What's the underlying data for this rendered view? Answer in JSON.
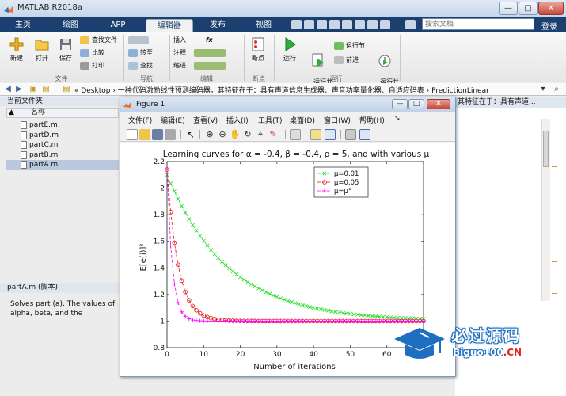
{
  "window": {
    "title": "MATLAB R2018a",
    "min_glyph": "—",
    "max_glyph": "□",
    "close_glyph": "✕"
  },
  "ribbon_tabs": [
    {
      "label": "主页"
    },
    {
      "label": "绘图"
    },
    {
      "label": "APP"
    },
    {
      "label": "编辑器"
    },
    {
      "label": "发布"
    },
    {
      "label": "视图"
    }
  ],
  "search": {
    "placeholder": "搜索文档"
  },
  "login_label": "登录",
  "ribbon": {
    "file_group": {
      "label": "文件",
      "new": "新建",
      "open": "打开",
      "save": "保存",
      "find_files": "查找文件",
      "compare": "比较",
      "print": "打印"
    },
    "nav_group": {
      "label": "导航",
      "goto": "转至",
      "find": "查找"
    },
    "edit_group": {
      "label": "编辑",
      "insert": "插入",
      "comment": "注释",
      "indent": "缩进",
      "fx": "fx"
    },
    "breakpoint_group": {
      "label": "断点",
      "breakpoints": "断点"
    },
    "run_group": {
      "label": "运行",
      "run": "运行",
      "run_advance": "运行并\n前进",
      "run_section": "运行节",
      "advance": "前进",
      "run_time": "运行并\n计时"
    }
  },
  "address": {
    "path": "«  Desktop  ›  一种代码激励线性预测编码器，其特征在于：具有声道信息生成器、声音功率量化器、自适应码表  ›  PredictionLinear"
  },
  "left_panel": {
    "title": "当前文件夹",
    "column_name": "名称",
    "sort_glyph": "▲",
    "files": [
      "partE.m",
      "partD.m",
      "partC.m",
      "partB.m",
      "partA.m"
    ],
    "selected_index": 4,
    "detail_title": "partA.m  (脚本)",
    "detail_text": "Solves part (a). The values of alpha, beta, and the"
  },
  "right_panel": {
    "header": "其特征在于：具有声道..."
  },
  "figure": {
    "title": "Figure 1",
    "menu": [
      "文件(F)",
      "编辑(E)",
      "查看(V)",
      "插入(I)",
      "工具(T)",
      "桌面(D)",
      "窗口(W)",
      "帮助(H)"
    ]
  },
  "chart_data": {
    "type": "line",
    "title": "Learning curves for α = -0.4, β = -0.4, ρ = 5, and with various μ",
    "xlabel": "Number of iterations",
    "ylabel": "E[e(i)]²",
    "xlim": [
      0,
      70
    ],
    "ylim": [
      0.8,
      2.2
    ],
    "xticks": [
      0,
      10,
      20,
      30,
      40,
      50,
      60,
      70
    ],
    "yticks": [
      0.8,
      1,
      1.2,
      1.4,
      1.6,
      1.8,
      2,
      2.2
    ],
    "grid": false,
    "legend_position": "top-right",
    "series": [
      {
        "name": "μ=0.01",
        "color": "#22dd22",
        "marker": "x",
        "start": 2.1,
        "asymptote": 1.0,
        "rate": 0.06
      },
      {
        "name": "μ=0.05",
        "color": "#e01010",
        "marker": "o",
        "start": 2.14,
        "asymptote": 1.0,
        "rate": 0.33
      },
      {
        "name": "μ=μ°",
        "color": "#ff00ff",
        "marker": "+",
        "start": 2.14,
        "asymptote": 1.0,
        "rate": 0.7
      }
    ]
  },
  "watermark": {
    "brand_cn": "必过源码",
    "brand_en": "Biguo100",
    "brand_tld": ".CN"
  }
}
